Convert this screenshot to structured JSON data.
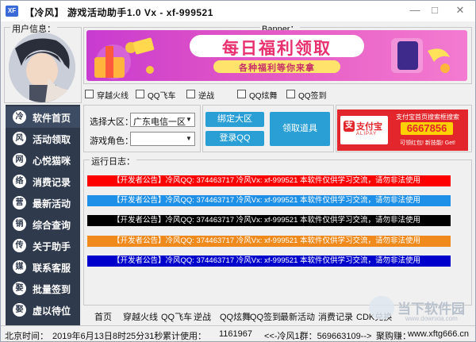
{
  "window": {
    "icon_text": "XF",
    "title": "【冷风】 游戏活动助手1.0    Vx - xf-999521"
  },
  "groups": {
    "user_info": "用户信息：",
    "banner": "Banner：",
    "log": "运行日志："
  },
  "banner": {
    "headline": "每日福利领取",
    "subline": "各种福利等你来拿"
  },
  "sidebar": {
    "items": [
      {
        "icon": "冷",
        "label": "软件首页"
      },
      {
        "icon": "风",
        "label": "活动领取"
      },
      {
        "icon": "网",
        "label": "心悦猫咪"
      },
      {
        "icon": "络",
        "label": "消费记录"
      },
      {
        "icon": "营",
        "label": "最新活动"
      },
      {
        "icon": "销",
        "label": "综合查询"
      },
      {
        "icon": "传",
        "label": "关于助手"
      },
      {
        "icon": "媒",
        "label": "联系客服"
      },
      {
        "icon": "娶",
        "label": "批量签到"
      },
      {
        "icon": "娶",
        "label": "虚以待位"
      }
    ]
  },
  "checkboxes": [
    "穿越火线",
    "QQ飞车",
    "逆战",
    "QQ炫舞",
    "QQ签到"
  ],
  "form": {
    "region_label": "选择大区：",
    "region_value": "广东电信一区",
    "role_label": "游戏角色：",
    "role_value": ""
  },
  "buttons": {
    "bind": "绑定大区",
    "login": "登录QQ",
    "claim": "领取道具"
  },
  "ad": {
    "brand": "支付宝",
    "brand_en": "ALIPAY",
    "line1": "支付宝首页搜索框搜索",
    "code": "6667856",
    "line2": "可领红包! 新技能! Get!"
  },
  "notices": [
    {
      "text": "【开发者公告】冷风QQ: 374463717  冷风Vx: xf-999521  本软件仅供学习交流，请勿非法使用",
      "color": "#ff0000"
    },
    {
      "text": "【开发者公告】冷风QQ: 374463717  冷风Vx: xf-999521  本软件仅供学习交流，请勿非法使用",
      "color": "#1e90e8"
    },
    {
      "text": "【开发者公告】冷风QQ: 374463717  冷风Vx: xf-999521  本软件仅供学习交流，请勿非法使用",
      "color": "#000000"
    },
    {
      "text": "【开发者公告】冷风QQ: 374463717  冷风Vx: xf-999521  本软件仅供学习交流，请勿非法使用",
      "color": "#f08a1c"
    },
    {
      "text": "【开发者公告】冷风QQ: 374463717  冷风Vx: xf-999521  本软件仅供学习交流，请勿非法使用",
      "color": "#0000cc"
    }
  ],
  "tabs": [
    "首页",
    "穿越火线",
    "QQ飞车",
    "逆战",
    "QQ炫舞",
    "QQ签到",
    "最新活动",
    "消费记录",
    "CDK兑换"
  ],
  "status": {
    "time_label": "北京时间：",
    "time_value": "2019年6月13日8时25分31秒",
    "usage_label": "累计使用：",
    "usage_value": "1161967",
    "group_text": "<<-冷风1群：569663109-->",
    "contact_label": "聚购赚：",
    "contact_value": "www.xftg666.cn"
  },
  "watermark": {
    "brand": "当下软件园",
    "url": "www.downxia.com"
  }
}
